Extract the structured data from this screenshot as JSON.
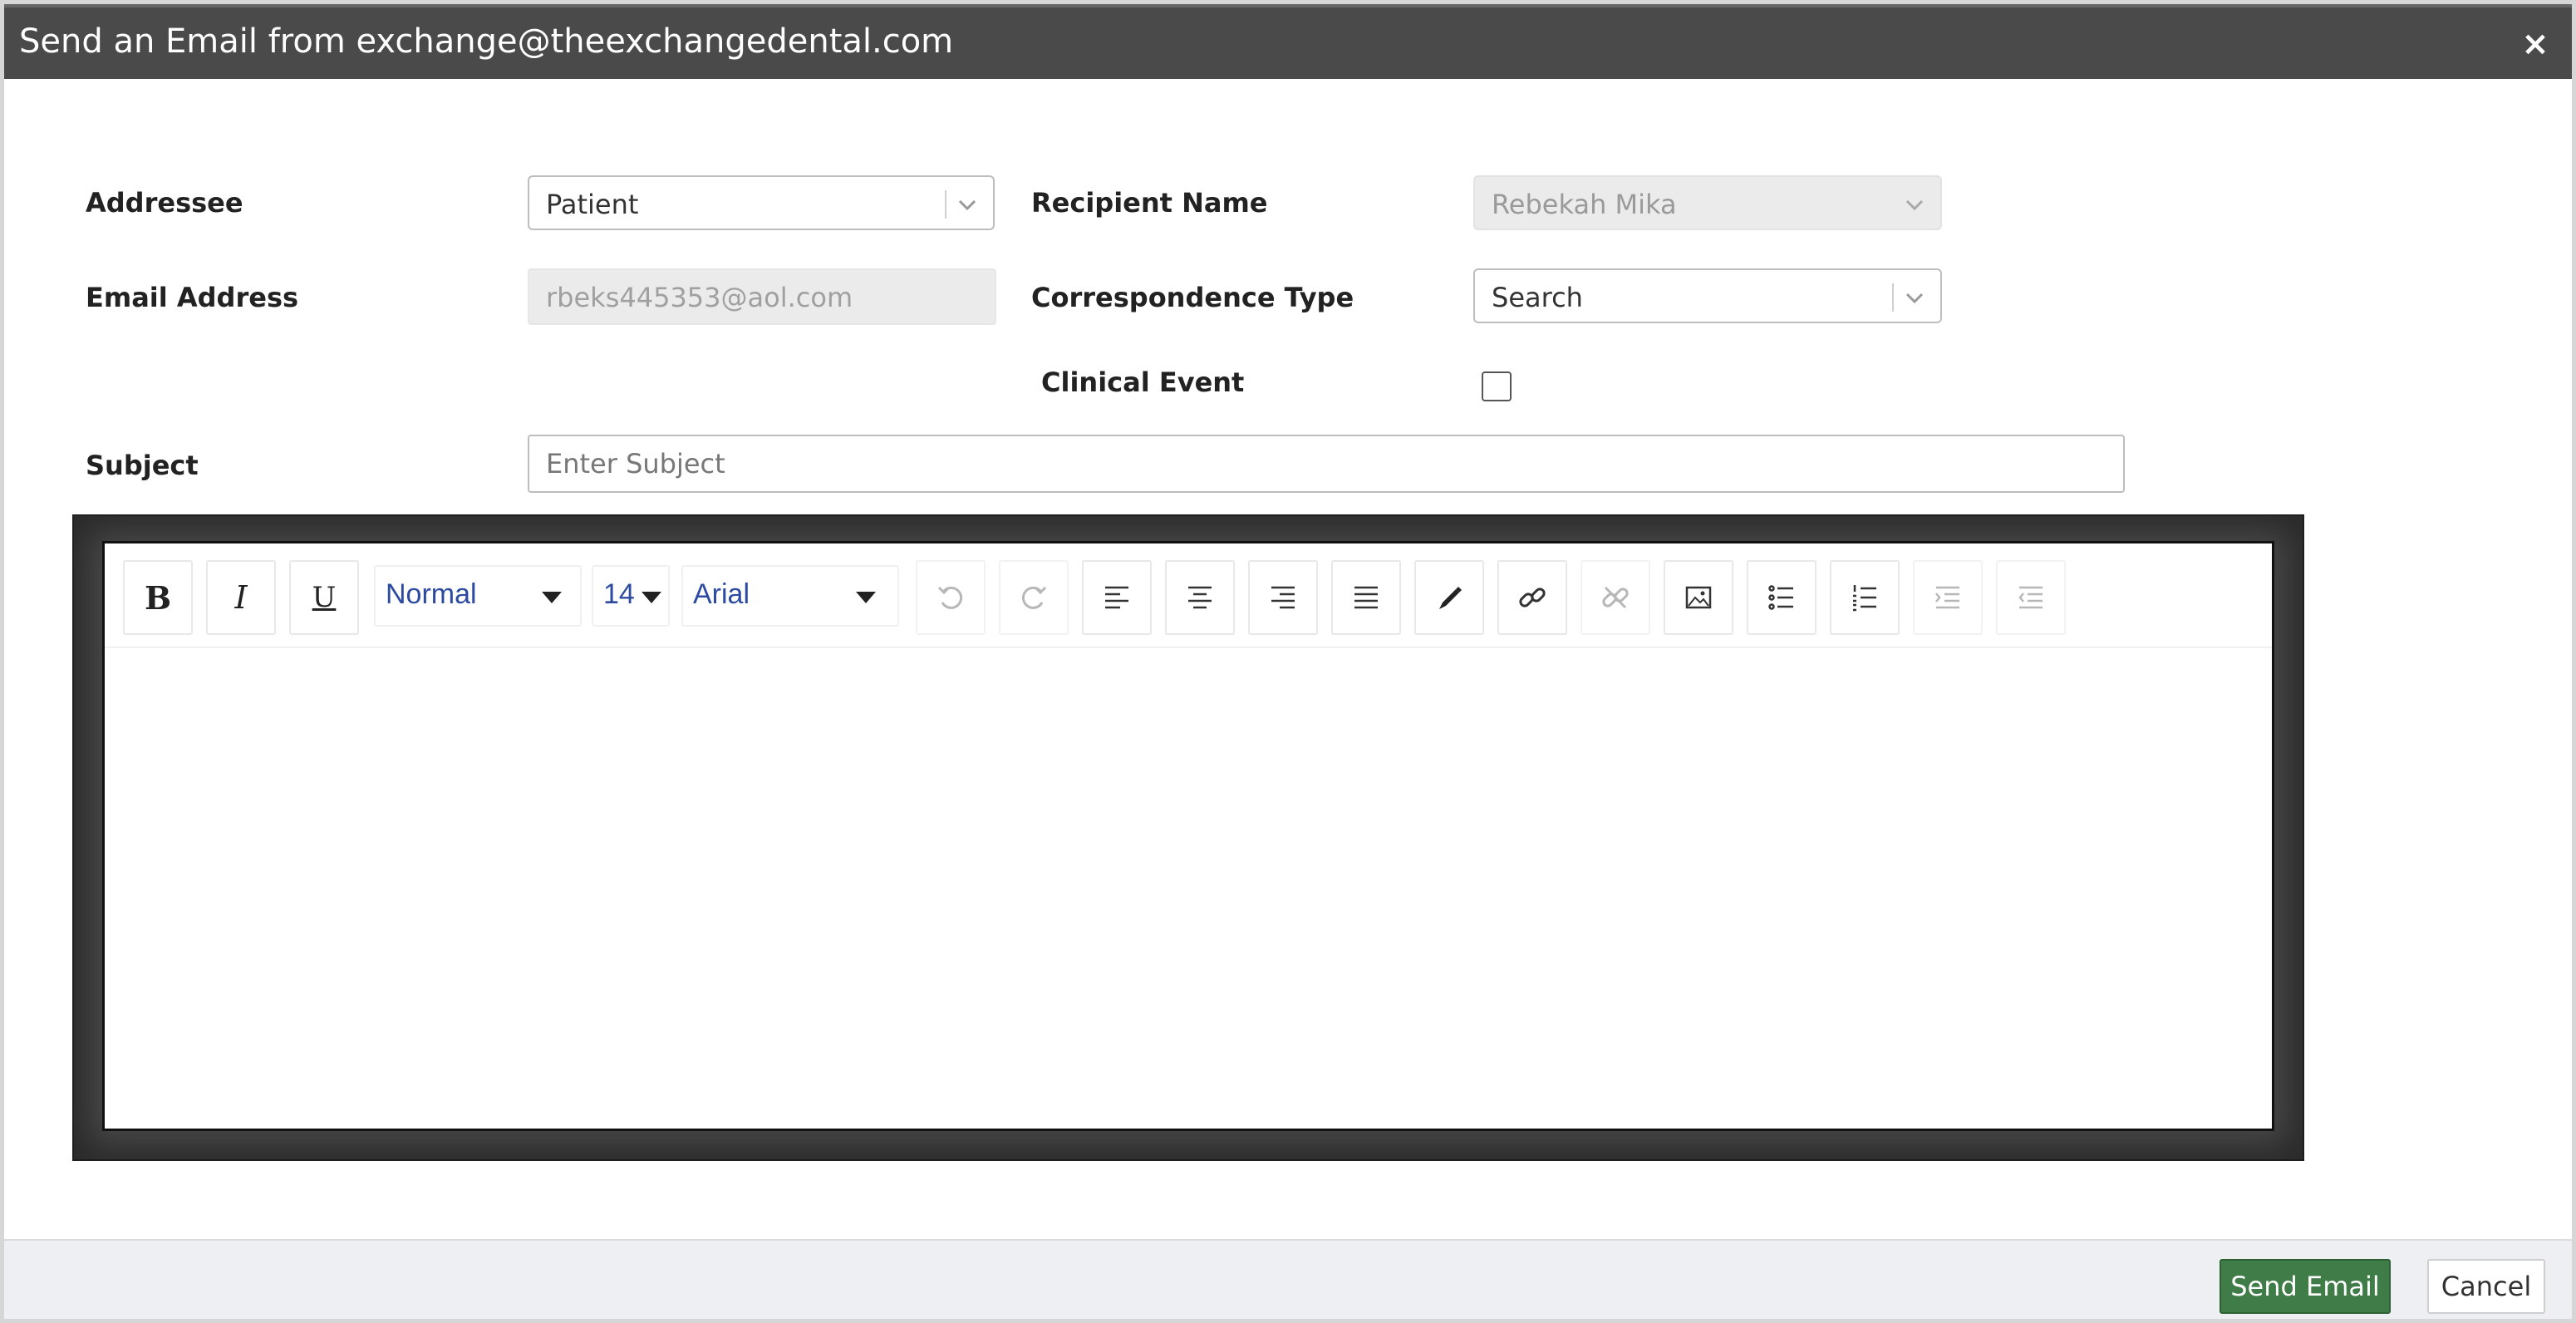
{
  "dialog": {
    "title": "Send an Email from exchange@theexchangedental.com",
    "close_label": "×"
  },
  "form": {
    "addressee": {
      "label": "Addressee",
      "value": "Patient"
    },
    "recipient_name": {
      "label": "Recipient Name",
      "value": "Rebekah Mika",
      "disabled": true
    },
    "email_address": {
      "label": "Email Address",
      "value": "rbeks445353@aol.com"
    },
    "correspondence_type": {
      "label": "Correspondence Type",
      "placeholder": "Search"
    },
    "clinical_event": {
      "label": "Clinical Event",
      "checked": false
    },
    "subject": {
      "label": "Subject",
      "placeholder": "Enter Subject",
      "value": ""
    }
  },
  "editor": {
    "toolbar": {
      "bold_label": "B",
      "italic_label": "I",
      "underline_label": "U",
      "paragraph_style": "Normal",
      "font_size": "14",
      "font_family": "Arial",
      "buttons": [
        "bold-icon",
        "italic-icon",
        "underline-icon",
        "undo-icon",
        "redo-icon",
        "align-left-icon",
        "align-center-icon",
        "align-right-icon",
        "align-justify-icon",
        "text-color-icon",
        "link-icon",
        "unlink-icon",
        "image-icon",
        "bullet-list-icon",
        "numbered-list-icon",
        "indent-icon",
        "outdent-icon"
      ]
    },
    "content": ""
  },
  "footer": {
    "send_label": "Send Email",
    "cancel_label": "Cancel"
  },
  "colors": {
    "titlebar": "#4a4a4a",
    "send_button": "#3f7c47",
    "toolbar_select_text": "#2b4aa0",
    "footer_bg": "#eeeff2"
  }
}
